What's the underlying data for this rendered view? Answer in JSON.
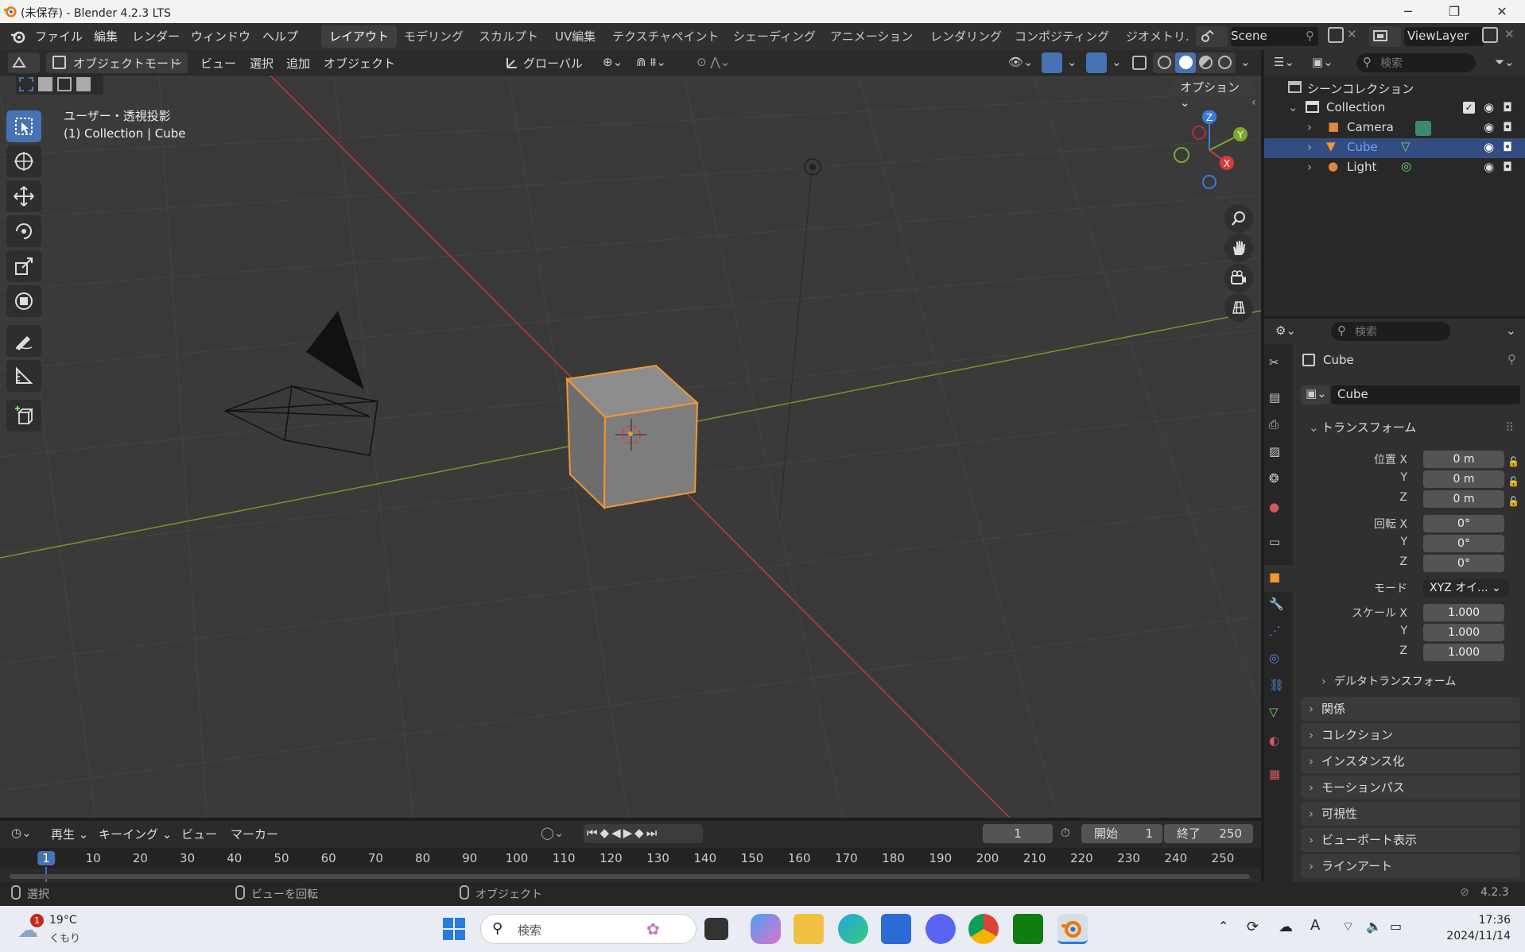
{
  "window": {
    "title": "(未保存) - Blender 4.2.3 LTS",
    "minimize": "─",
    "maximize": "❐",
    "close": "✕"
  },
  "menu": [
    "ファイル",
    "編集",
    "レンダー",
    "ウィンドウ",
    "ヘルプ"
  ],
  "workspaces": [
    "レイアウト",
    "モデリング",
    "スカルプト",
    "UV編集",
    "テクスチャペイント",
    "シェーディング",
    "アニメーション",
    "レンダリング",
    "コンポジティング",
    "ジオメトリ."
  ],
  "scene": {
    "name": "Scene",
    "view_layer": "ViewLayer"
  },
  "viewport_header": {
    "mode": "オブジェクトモード",
    "view": "ビュー",
    "select": "選択",
    "add": "追加",
    "object": "オブジェクト",
    "orientation": "グローバル",
    "options": "オプション"
  },
  "viewport_info": {
    "line1": "ユーザー・透視投影",
    "line2": "(1) Collection | Cube"
  },
  "gizmo": {
    "x": "X",
    "y": "Y",
    "z": "Z"
  },
  "outliner": {
    "search_placeholder": "検索",
    "root": "シーンコレクション",
    "collection": "Collection",
    "items": [
      {
        "name": "Camera",
        "selected": false
      },
      {
        "name": "Cube",
        "selected": true
      },
      {
        "name": "Light",
        "selected": false
      }
    ]
  },
  "properties": {
    "search_placeholder": "検索",
    "object_name": "Cube",
    "data_name": "Cube",
    "transform": {
      "title": "トランスフォーム",
      "location_label": "位置 X",
      "location": [
        "0 m",
        "0 m",
        "0 m"
      ],
      "rotation_label": "回転 X",
      "rotation": [
        "0°",
        "0°",
        "0°"
      ],
      "mode_label": "モード",
      "mode": "XYZ オイ...",
      "scale_label": "スケール X",
      "scale": [
        "1.000",
        "1.000",
        "1.000"
      ],
      "axis_y": "Y",
      "axis_z": "Z",
      "delta": "デルタトランスフォーム"
    },
    "panels": [
      "関係",
      "コレクション",
      "インスタンス化",
      "モーションパス",
      "可視性",
      "ビューポート表示",
      "ラインアート"
    ]
  },
  "timeline": {
    "playback": "再生",
    "keying": "キーイング",
    "view": "ビュー",
    "marker": "マーカー",
    "current_frame": "1",
    "start_label": "開始",
    "start": "1",
    "end_label": "終了",
    "end": "250",
    "ruler": [
      "1",
      "10",
      "20",
      "30",
      "40",
      "50",
      "60",
      "70",
      "80",
      "90",
      "100",
      "110",
      "120",
      "130",
      "140",
      "150",
      "160",
      "170",
      "180",
      "190",
      "200",
      "210",
      "220",
      "230",
      "240",
      "250"
    ]
  },
  "statusbar": {
    "select": "選択",
    "rotate": "ビューを回転",
    "object": "オブジェクト",
    "version": "4.2.3"
  },
  "taskbar": {
    "weather_temp": "19°C",
    "weather_desc": "くもり",
    "weather_badge": "1",
    "search": "検索",
    "time": "17:36",
    "date": "2024/11/14"
  },
  "colors": {
    "accent": "#4772b3",
    "selected_outline": "#f5962f",
    "x_axis": "#d63a3a",
    "y_axis": "#7aa830",
    "z_axis": "#3b7ae0"
  }
}
